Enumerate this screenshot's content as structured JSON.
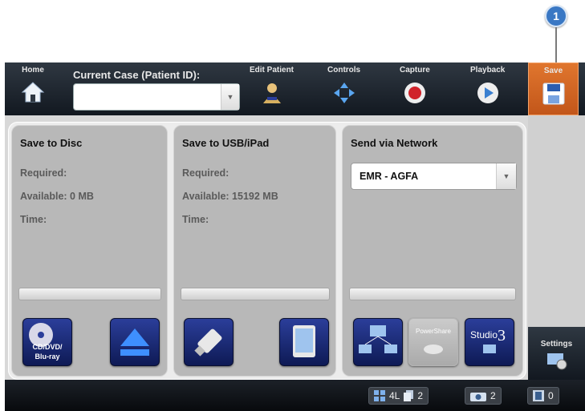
{
  "callout": "1",
  "nav": {
    "home": "Home",
    "current_case_label": "Current Case (Patient ID):",
    "current_case_value": "",
    "edit_patient": "Edit Patient",
    "controls": "Controls",
    "capture": "Capture",
    "playback": "Playback",
    "save": "Save"
  },
  "panels": {
    "disc": {
      "title": "Save to Disc",
      "required": "Required:",
      "available": "Available: 0 MB",
      "time": "Time:",
      "button_label_1": "CD/DVD/",
      "button_label_2": "Blu-ray"
    },
    "usb": {
      "title": "Save to USB/iPad",
      "required": "Required:",
      "available": "Available: 15192 MB",
      "time": "Time:"
    },
    "network": {
      "title": "Send via Network",
      "selected": "EMR - AGFA",
      "powershare": "PowerShare",
      "studio": "Studio",
      "studio_num": "3"
    }
  },
  "settings": "Settings",
  "status": {
    "layout": "4L",
    "copies": "2",
    "photos": "2",
    "videos": "0"
  },
  "colors": {
    "accent_save": "#d9682a",
    "button_blue": "#1c2c7a",
    "bar_dark": "#121820"
  }
}
